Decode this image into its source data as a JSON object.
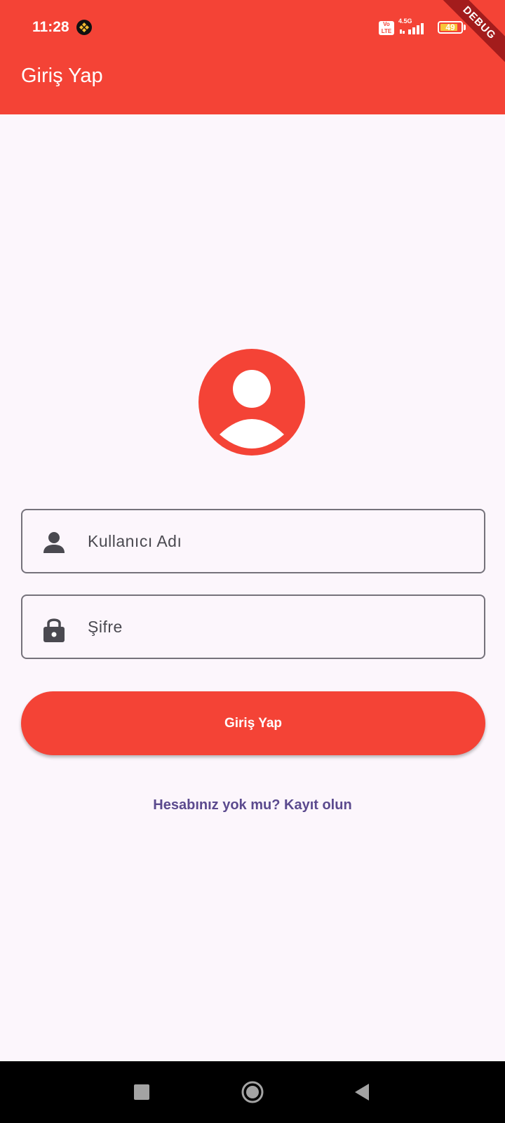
{
  "status_bar": {
    "time": "11:28",
    "network_label": "4.5G",
    "volte_label": "Vo LTE",
    "battery_level": "49",
    "icons": [
      "binance-icon",
      "volte-icon",
      "signal-icon",
      "battery-icon"
    ]
  },
  "app_bar": {
    "title": "Giriş Yap",
    "debug_banner": "DEBUG"
  },
  "avatar": {
    "icon": "account-circle-icon"
  },
  "form": {
    "username": {
      "placeholder": "Kullanıcı Adı",
      "icon": "person-icon"
    },
    "password": {
      "placeholder": "Şifre",
      "icon": "lock-icon"
    },
    "login_button": "Giriş Yap",
    "register_link": "Hesabınız yok mu? Kayıt olun"
  },
  "navigation_bar": {
    "icons": [
      "recents-icon",
      "home-icon",
      "back-icon"
    ]
  },
  "colors": {
    "primary": "#f44336",
    "background": "#fcf6fc",
    "link": "#5b4a8e",
    "field_border": "#75727b",
    "text_muted": "#4a4950"
  }
}
